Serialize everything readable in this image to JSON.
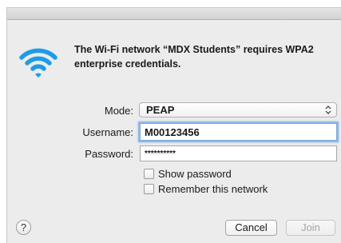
{
  "message": "The Wi-Fi network “MDX Students” requires WPA2 enterprise credentials.",
  "form": {
    "mode_label": "Mode:",
    "mode_value": "PEAP",
    "username_label": "Username:",
    "username_value": "M00123456",
    "password_label": "Password:",
    "password_value": "**********"
  },
  "options": {
    "show_password": "Show password",
    "show_password_checked": false,
    "remember_network": "Remember this network",
    "remember_network_checked": false
  },
  "buttons": {
    "help": "?",
    "cancel": "Cancel",
    "join": "Join"
  },
  "colors": {
    "wifi_icon": "#1e9be8",
    "focus_ring": "#91b8e6",
    "dialog_bg": "#ececec"
  },
  "icons": {
    "wifi": "wifi-icon",
    "select_arrows": "chevron-up-down-icon"
  }
}
